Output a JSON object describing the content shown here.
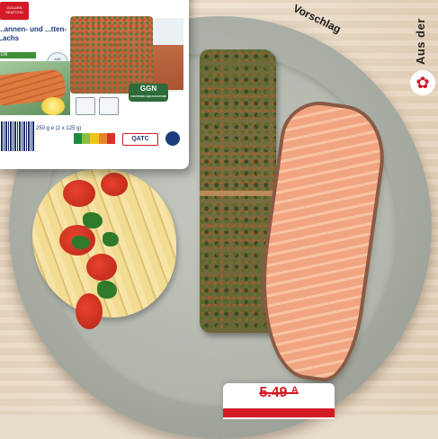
{
  "package": {
    "logo_text": "GOLDEN SEAFOOD",
    "title": "...annen- und ...tten-Lachs",
    "variant": "Dill",
    "fischer_badge": "AUS FISCHERS LACHS",
    "ggn_label": "GGN",
    "ggn_sub": "CERTIFIED AQUACULTURE",
    "weight": "250 g e (2 x 125 g)",
    "nutri_score_label": "NUTRI-SCORE",
    "qatc_label": "QATC"
  },
  "side_banner": {
    "text": "Aus der",
    "icon": "region-flower-icon"
  },
  "serving_suggestion": "Vorschlag",
  "price": {
    "old_price": "5.49 ᴬ"
  },
  "colors": {
    "brand_red": "#d21b26",
    "brand_blue": "#1d3b7a",
    "nutri_colors": [
      "#1b8c3c",
      "#8cbf3f",
      "#f2c316",
      "#e58624",
      "#d7332a"
    ]
  }
}
